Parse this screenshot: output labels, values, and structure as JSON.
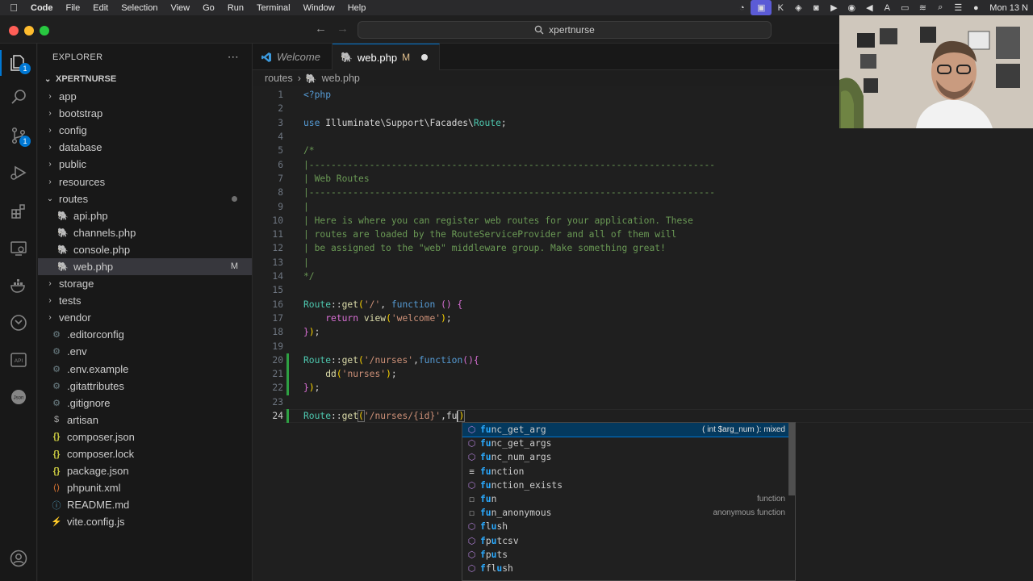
{
  "menubar": {
    "app": "Code",
    "items": [
      "File",
      "Edit",
      "Selection",
      "View",
      "Go",
      "Run",
      "Terminal",
      "Window",
      "Help"
    ],
    "clock": "Mon 13 N"
  },
  "titlebar": {
    "search": "xpertnurse"
  },
  "activity": {
    "explorer_badge": "1",
    "scm_badge": "1"
  },
  "explorer": {
    "header": "EXPLORER",
    "project": "XPERTNURSE",
    "items": [
      {
        "name": "app",
        "type": "folder"
      },
      {
        "name": "bootstrap",
        "type": "folder"
      },
      {
        "name": "config",
        "type": "folder"
      },
      {
        "name": "database",
        "type": "folder"
      },
      {
        "name": "public",
        "type": "folder"
      },
      {
        "name": "resources",
        "type": "folder"
      },
      {
        "name": "routes",
        "type": "folder-open"
      },
      {
        "name": "api.php",
        "type": "php"
      },
      {
        "name": "channels.php",
        "type": "php"
      },
      {
        "name": "console.php",
        "type": "php"
      },
      {
        "name": "web.php",
        "type": "php",
        "status": "M"
      },
      {
        "name": "storage",
        "type": "folder"
      },
      {
        "name": "tests",
        "type": "folder"
      },
      {
        "name": "vendor",
        "type": "folder"
      },
      {
        "name": ".editorconfig",
        "type": "gear"
      },
      {
        "name": ".env",
        "type": "gear"
      },
      {
        "name": ".env.example",
        "type": "gear"
      },
      {
        "name": ".gitattributes",
        "type": "gear"
      },
      {
        "name": ".gitignore",
        "type": "gear"
      },
      {
        "name": "artisan",
        "type": "dollar"
      },
      {
        "name": "composer.json",
        "type": "json"
      },
      {
        "name": "composer.lock",
        "type": "json"
      },
      {
        "name": "package.json",
        "type": "json"
      },
      {
        "name": "phpunit.xml",
        "type": "xml"
      },
      {
        "name": "README.md",
        "type": "info"
      },
      {
        "name": "vite.config.js",
        "type": "js"
      }
    ]
  },
  "tabs": [
    {
      "label": "Welcome"
    },
    {
      "label": "web.php",
      "status": "M"
    }
  ],
  "breadcrumb": {
    "folder": "routes",
    "file": "web.php"
  },
  "editor": {
    "current_line": "24",
    "line_numbers": [
      "1",
      "2",
      "3",
      "4",
      "5",
      "6",
      "7",
      "8",
      "9",
      "10",
      "11",
      "12",
      "13",
      "14",
      "15",
      "16",
      "17",
      "18",
      "19",
      "20",
      "21",
      "22",
      "23",
      "24"
    ],
    "code": {
      "l1": "<?php",
      "l3_use": "use",
      "l3_ns": "Illuminate\\Support\\Facades\\",
      "l3_cls": "Route",
      "l5": "/*",
      "l6": "|--------------------------------------------------------------------------",
      "l7": "| Web Routes",
      "l8": "|--------------------------------------------------------------------------",
      "l9": "|",
      "l10": "| Here is where you can register web routes for your application. These",
      "l11": "| routes are loaded by the RouteServiceProvider and all of them will",
      "l12": "| be assigned to the \"web\" middleware group. Make something great!",
      "l13": "|",
      "l14": "*/",
      "route": "Route",
      "get": "get",
      "function": "function",
      "return": "return",
      "view": "view",
      "s_root": "'/'",
      "s_welcome": "'welcome'",
      "s_nurses": "'/nurses'",
      "dd": "dd",
      "s_nurses2": "'nurses'",
      "s_id": "'/nurses/{id}'",
      "typed": "fu"
    }
  },
  "suggestions": [
    {
      "label": "func_get_arg",
      "match": "fu",
      "rest": "nc_get_arg",
      "kind": "method",
      "detail": "( int $arg_num ): mixed"
    },
    {
      "label": "func_get_args",
      "match": "fu",
      "rest": "nc_get_args",
      "kind": "method"
    },
    {
      "label": "func_num_args",
      "match": "fu",
      "rest": "nc_num_args",
      "kind": "method"
    },
    {
      "label": "function",
      "match": "fu",
      "rest": "nction",
      "kind": "keyword"
    },
    {
      "label": "function_exists",
      "match": "fu",
      "rest": "nction_exists",
      "kind": "method"
    },
    {
      "label": "fun",
      "match": "fu",
      "rest": "n",
      "kind": "snippet",
      "detail": "function"
    },
    {
      "label": "fun_anonymous",
      "match": "fu",
      "rest": "n_anonymous",
      "kind": "snippet",
      "detail": "anonymous function"
    },
    {
      "label": "flush",
      "match": "f",
      "mid": "l",
      "match2": "u",
      "rest": "sh",
      "kind": "method"
    },
    {
      "label": "fputcsv",
      "match": "f",
      "mid": "p",
      "match2": "u",
      "rest": "tcsv",
      "kind": "method"
    },
    {
      "label": "fputs",
      "match": "f",
      "mid": "p",
      "match2": "u",
      "rest": "ts",
      "kind": "method"
    },
    {
      "label": "fflush",
      "match": "f",
      "mid": "fl",
      "match2": "u",
      "rest": "sh",
      "kind": "method"
    }
  ],
  "colors": {
    "accent": "#0078d4",
    "modified": "#e2c08d",
    "php_icon": "#a074c4"
  }
}
